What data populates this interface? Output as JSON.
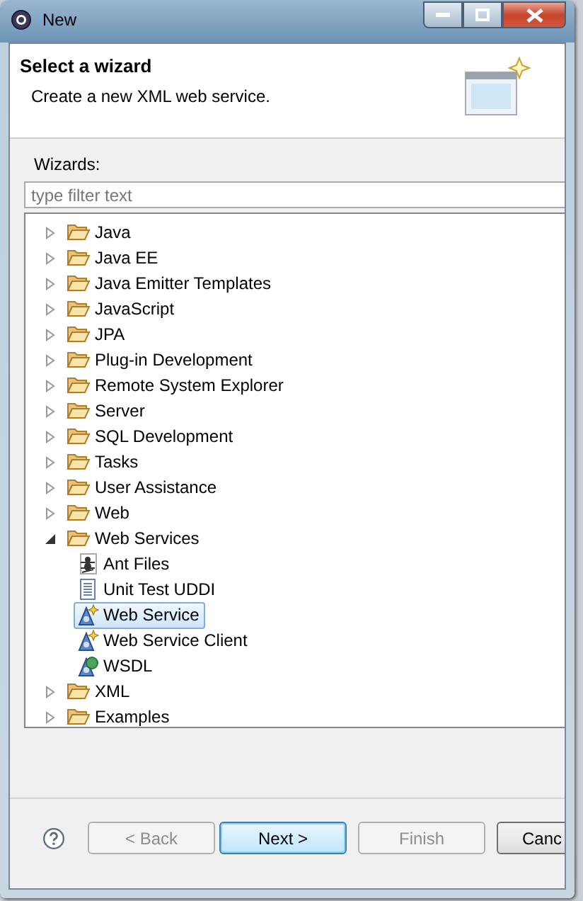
{
  "window": {
    "title": "New"
  },
  "header": {
    "title": "Select a wizard",
    "description": "Create a new XML web service."
  },
  "wizards_label": "Wizards:",
  "filter": {
    "placeholder": "type filter text"
  },
  "tree": [
    {
      "label": "Java",
      "kind": "folder",
      "expanded": false
    },
    {
      "label": "Java EE",
      "kind": "folder",
      "expanded": false
    },
    {
      "label": "Java Emitter Templates",
      "kind": "folder",
      "expanded": false
    },
    {
      "label": "JavaScript",
      "kind": "folder",
      "expanded": false
    },
    {
      "label": "JPA",
      "kind": "folder",
      "expanded": false
    },
    {
      "label": "Plug-in Development",
      "kind": "folder",
      "expanded": false
    },
    {
      "label": "Remote System Explorer",
      "kind": "folder",
      "expanded": false
    },
    {
      "label": "Server",
      "kind": "folder",
      "expanded": false
    },
    {
      "label": "SQL Development",
      "kind": "folder",
      "expanded": false
    },
    {
      "label": "Tasks",
      "kind": "folder",
      "expanded": false
    },
    {
      "label": "User Assistance",
      "kind": "folder",
      "expanded": false
    },
    {
      "label": "Web",
      "kind": "folder",
      "expanded": false
    },
    {
      "label": "Web Services",
      "kind": "folder",
      "expanded": true,
      "children": [
        {
          "label": "Ant Files",
          "kind": "ant",
          "selected": false
        },
        {
          "label": "Unit Test UDDI",
          "kind": "document",
          "selected": false
        },
        {
          "label": "Web Service",
          "kind": "service",
          "selected": true
        },
        {
          "label": "Web Service Client",
          "kind": "client",
          "selected": false
        },
        {
          "label": "WSDL",
          "kind": "wsdl",
          "selected": false
        }
      ]
    },
    {
      "label": "XML",
      "kind": "folder",
      "expanded": false
    },
    {
      "label": "Examples",
      "kind": "folder",
      "expanded": false
    }
  ],
  "buttons": [
    {
      "label": "< Back",
      "disabled": true,
      "default": false
    },
    {
      "label": "Next >",
      "disabled": false,
      "default": true
    },
    {
      "label": "Finish",
      "disabled": true,
      "default": false
    },
    {
      "label": "Canc",
      "disabled": false,
      "default": false
    }
  ]
}
